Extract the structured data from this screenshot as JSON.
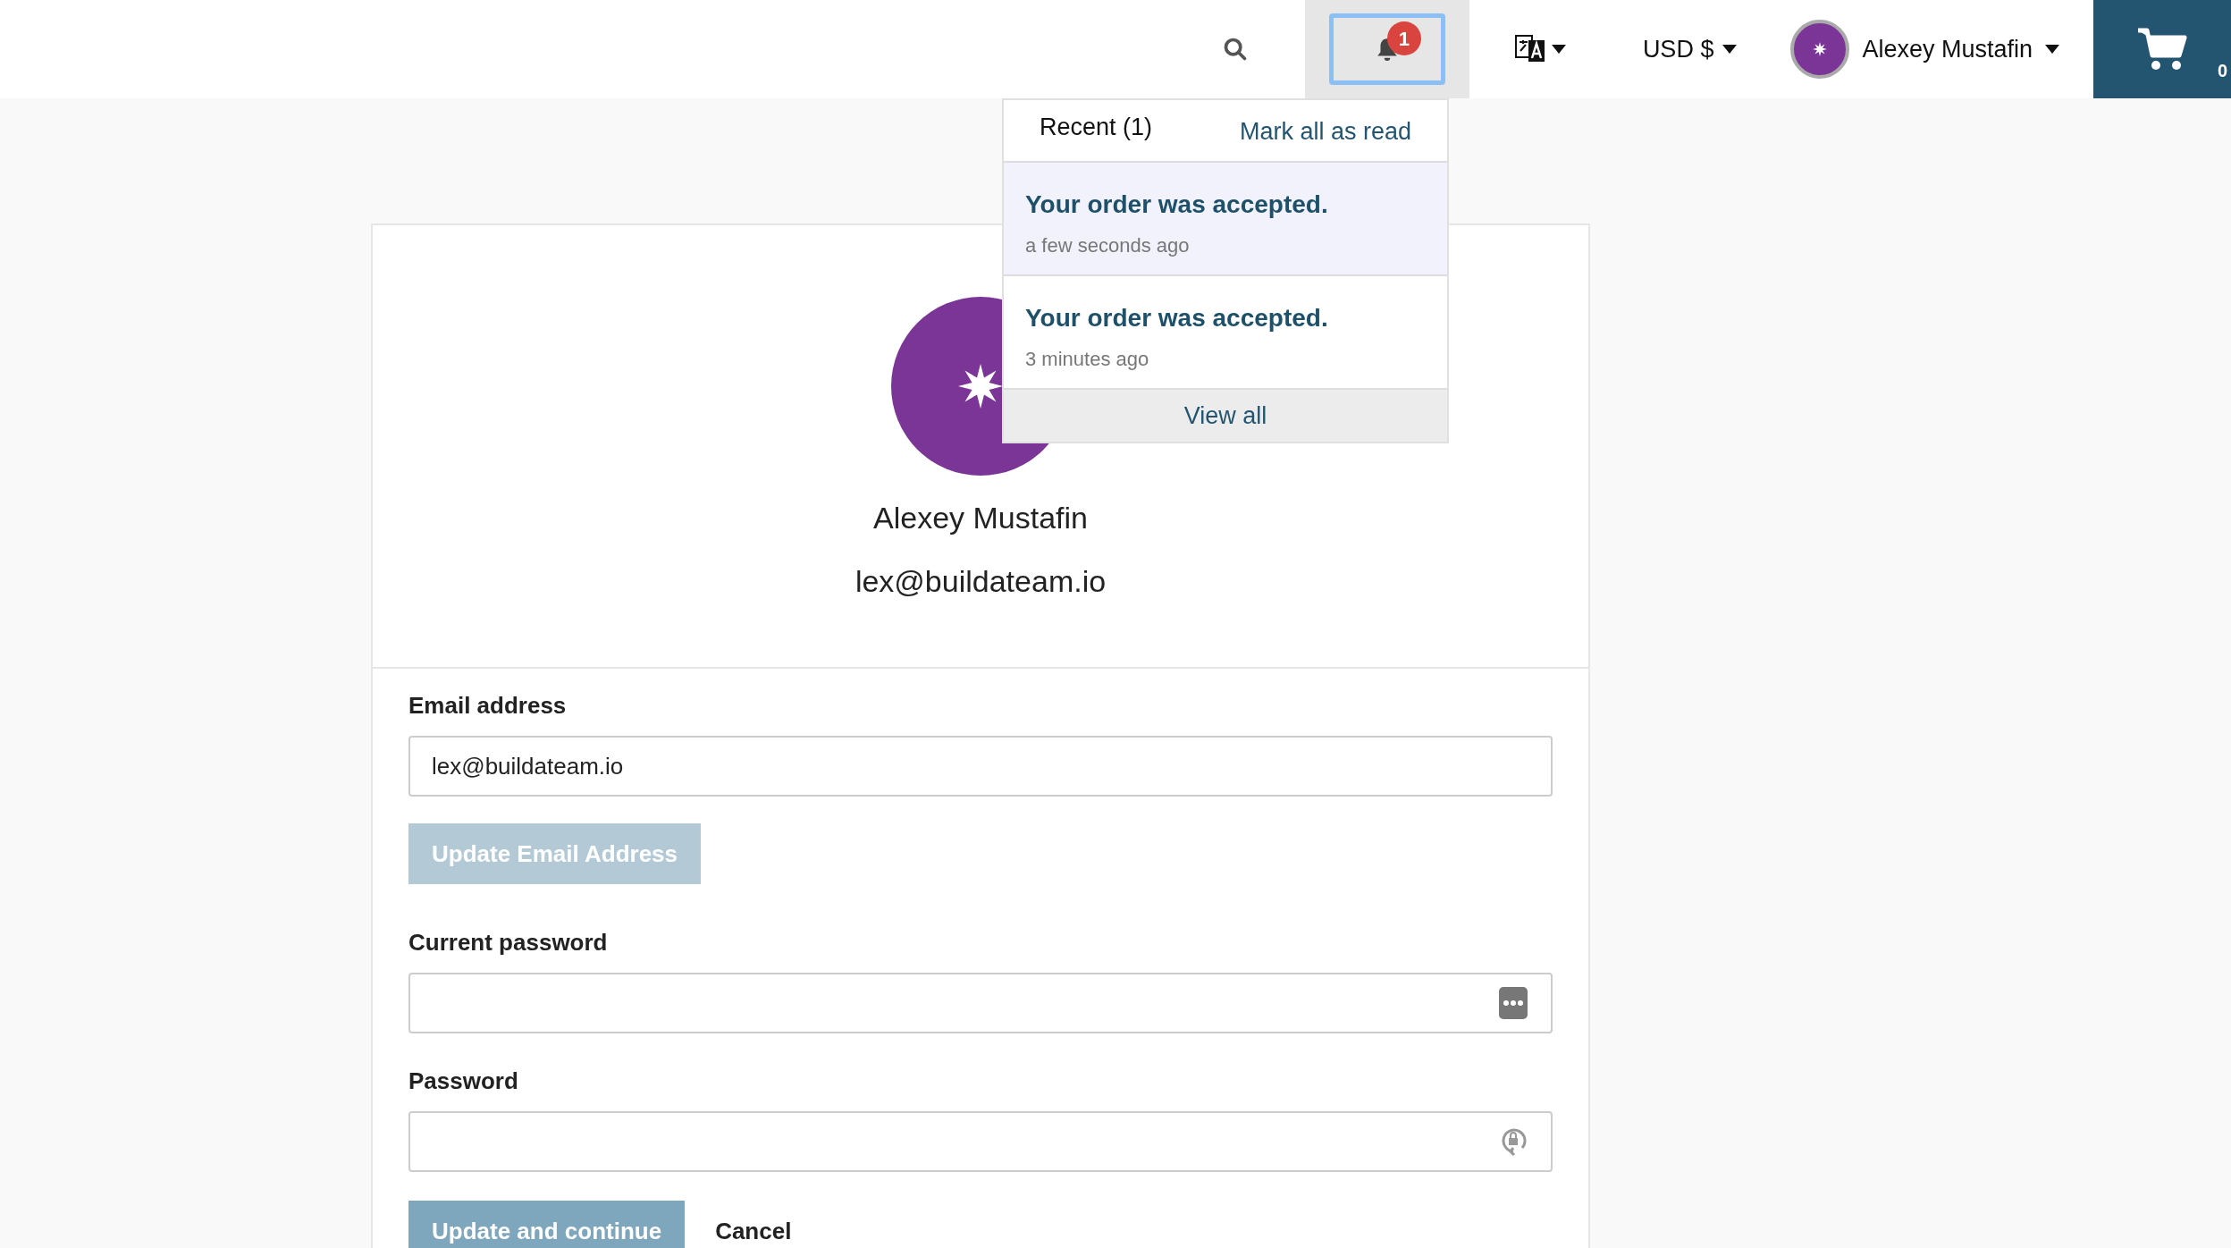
{
  "header": {
    "notifications_badge": "1",
    "notifications_open": true,
    "currency": "USD $",
    "user_name": "Alexey Mustafin",
    "cart_count": "0"
  },
  "notifications": {
    "tab": "Recent (1)",
    "mark_all": "Mark all as read",
    "items": [
      {
        "title": "Your order was accepted.",
        "time": "a few seconds ago",
        "unread": true
      },
      {
        "title": "Your order was accepted.",
        "time": "3 minutes ago",
        "unread": false
      }
    ],
    "view_all": "View all"
  },
  "profile": {
    "name": "Alexey Mustafin",
    "email": "lex@buildateam.io"
  },
  "form": {
    "email_label": "Email address",
    "email_value": "lex@buildateam.io",
    "update_email": "Update Email Address",
    "current_password_label": "Current password",
    "password_label": "Password",
    "submit": "Update and continue",
    "cancel": "Cancel"
  }
}
